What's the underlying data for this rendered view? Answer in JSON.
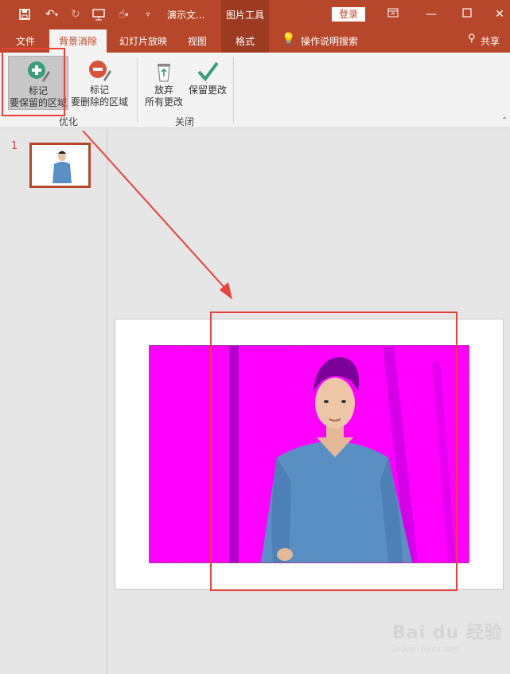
{
  "titlebar": {
    "doc_title": "演示文...",
    "context_title": "图片工具",
    "login_label": "登录",
    "icons": [
      "save-icon",
      "undo-icon",
      "redo-icon",
      "present-icon",
      "touch-icon",
      "customize-icon"
    ]
  },
  "tabs": [
    {
      "label": "文件"
    },
    {
      "label": "背景消除",
      "active": true
    },
    {
      "label": "幻灯片放映"
    },
    {
      "label": "视图"
    },
    {
      "label": "格式"
    }
  ],
  "tell_me": "操作说明搜索",
  "share": "共享",
  "ribbon": {
    "mark_keep": {
      "line1": "标记",
      "line2": "要保留的区域"
    },
    "mark_remove": {
      "line1": "标记",
      "line2": "要删除的区域"
    },
    "discard": {
      "line1": "放弃",
      "line2": "所有更改"
    },
    "keep_changes": {
      "line1": "保留更改"
    },
    "group_refine": "优化",
    "group_close": "关闭"
  },
  "slides": {
    "number": "1"
  },
  "colors": {
    "accent": "#b7472a",
    "removed_area": "#ff00ff",
    "annotation_red": "#e8413e",
    "shirt": "#5a8fc4"
  },
  "watermark": {
    "brand": "Bai du 经验",
    "url": "jingyan.baidu.com"
  }
}
